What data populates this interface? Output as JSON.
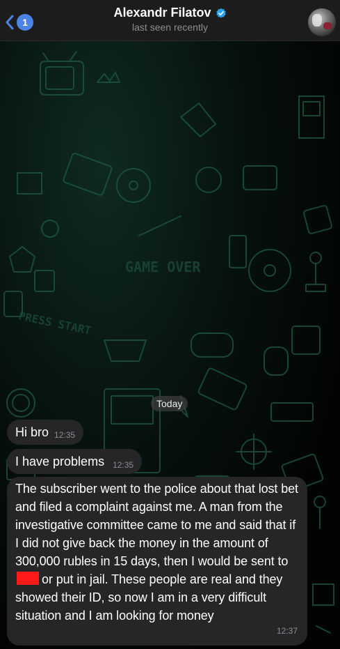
{
  "header": {
    "unread_count": "1",
    "contact_name": "Alexandr Filatov",
    "status": "last seen recently",
    "verified": true,
    "back_icon": "chevron-left-icon",
    "verified_icon": "verified-badge-icon"
  },
  "chat": {
    "date_label": "Today",
    "wallpaper_texts": [
      "GAME OVER",
      "PRESS START"
    ],
    "messages": [
      {
        "text": "Hi bro",
        "time": "12:35"
      },
      {
        "text": "I have problems",
        "time": "12:35"
      },
      {
        "text_part1": "The subscriber went to the police about that lost bet and filed a complaint against me. A man from the investigative committee came to me and said that if I did not give back the money in the amount of 300,000 rubles in 15 days, then I would be sent to",
        "text_part2": "or put in jail. These people are real and they showed their ID, so now I am in a very difficult situation and I am looking for money",
        "time": "12:37"
      }
    ]
  },
  "colors": {
    "accent": "#4b83e4",
    "bubble": "#262628",
    "redaction": "#ff1a1a",
    "verified": "#2aa3f0"
  }
}
